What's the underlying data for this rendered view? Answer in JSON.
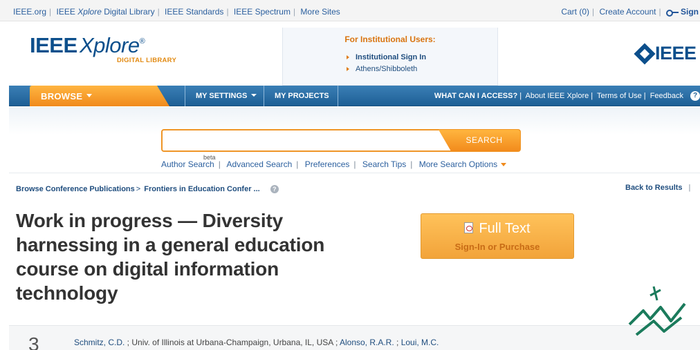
{
  "topbar": {
    "links": [
      "IEEE.org",
      "IEEE ",
      "Xplore",
      " Digital Library",
      "IEEE Standards",
      "IEEE Spectrum",
      "More Sites"
    ],
    "right": [
      "Cart (0)",
      "Create Account",
      "Sign"
    ]
  },
  "header": {
    "logo_main": "IEEE",
    "logo_xplore": "Xplore",
    "logo_reg": "®",
    "logo_sub": "DIGITAL LIBRARY",
    "inst_title": "For Institutional Users:",
    "inst_items": [
      "Institutional Sign In",
      "Athens/Shibboleth"
    ],
    "ieee_word": "IEEE"
  },
  "nav": {
    "browse": "BROWSE",
    "my_settings": "MY SETTINGS",
    "my_projects": "MY PROJECTS",
    "what_access": "WHAT CAN I ACCESS?",
    "about": "About IEEE Xplore",
    "terms": "Terms of Use",
    "feedback": "Feedback"
  },
  "search": {
    "value": "",
    "button": "SEARCH",
    "beta": "beta",
    "links": [
      "Author Search",
      "Advanced Search",
      "Preferences",
      "Search Tips",
      "More Search Options"
    ]
  },
  "breadcrumb": {
    "items": [
      "Browse Conference Publications",
      "Frontiers in Education Confer ..."
    ],
    "help": "?",
    "back": "Back to Results"
  },
  "article": {
    "title": "Work in progress — Diversity harnessing in a general education course on digital information technology",
    "full_text": "Full Text",
    "full_text_sub": "Sign-In or Purchase",
    "number": "3",
    "authors": [
      "Schmitz, C.D.",
      "Univ. of Illinois at Urbana-Champaign, Urbana, IL, USA",
      "Alonso, R.A.R.",
      "Loui, M.C."
    ]
  },
  "colors": {
    "accent_orange": "#f28b1c",
    "ieee_blue": "#0c4f8c",
    "nav_blue": "#1e5f95"
  }
}
